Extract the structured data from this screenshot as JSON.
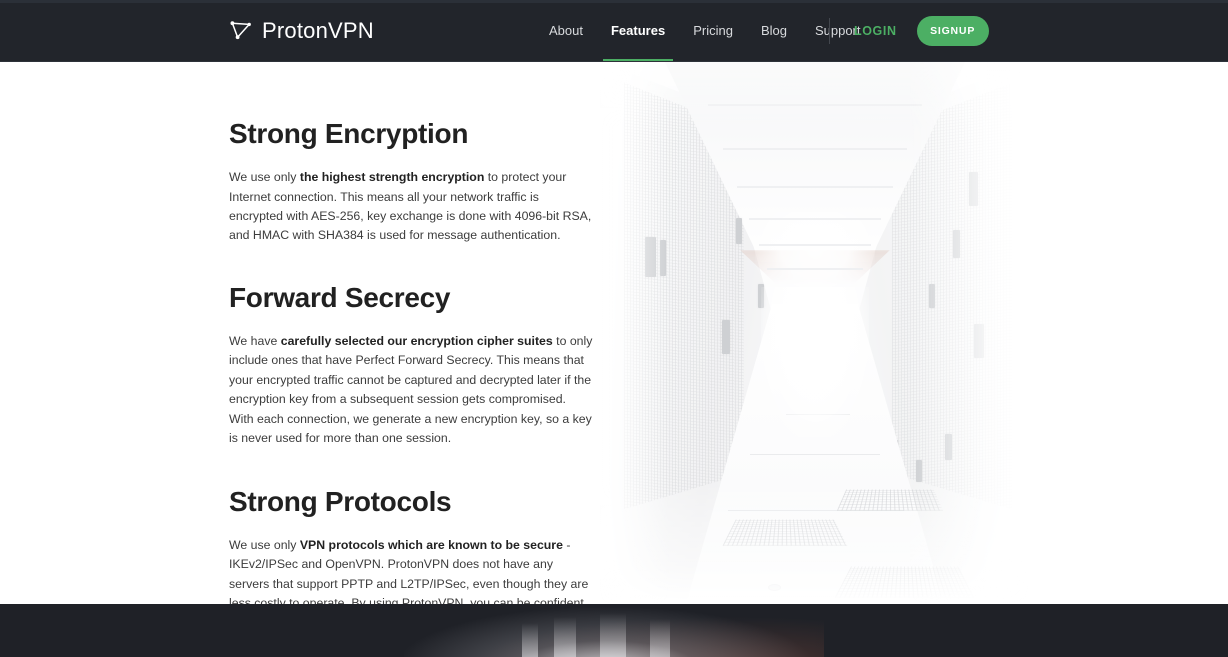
{
  "header": {
    "brand": {
      "name": "ProtonVPN",
      "icon": "proton-network-triangle-icon"
    },
    "nav": [
      {
        "label": "About",
        "active": false
      },
      {
        "label": "Features",
        "active": true
      },
      {
        "label": "Pricing",
        "active": false
      },
      {
        "label": "Blog",
        "active": false
      },
      {
        "label": "Support",
        "active": false
      }
    ],
    "login_label": "LOGIN",
    "signup_label": "SIGNUP",
    "colors": {
      "background": "#22252b",
      "accent_green": "#4caf64",
      "nav_text": "#d8dadd",
      "nav_active_text": "#ffffff"
    }
  },
  "main": {
    "sections": [
      {
        "title": "Strong Encryption",
        "body_lead": "We use only ",
        "body_bold": "the highest strength encryption",
        "body_rest": " to protect your Internet connection. This means all your network traffic is encrypted with AES-256, key exchange is done with 4096-bit RSA, and HMAC with SHA384 is used for message authentication."
      },
      {
        "title": "Forward Secrecy",
        "body_lead": "We have ",
        "body_bold": "carefully selected our encryption cipher suites",
        "body_rest": " to only include ones that have Perfect Forward Secrecy. This means that your encrypted traffic cannot be captured and decrypted later if the encryption key from a subsequent session gets compromised. With each connection, we generate a new encryption key, so a key is never used for more than one session."
      },
      {
        "title": "Strong Protocols",
        "body_lead": "We use only ",
        "body_bold": "VPN protocols which are known to be secure",
        "body_rest": " - IKEv2/IPSec and OpenVPN. ProtonVPN does not have any servers that support PPTP and L2TP/IPSec, even though they are less costly to operate. By using ProtonVPN, you can be confident that your VPN tunnel is protected by the most reliable protocol."
      }
    ],
    "hero_image": {
      "name": "data-center-corridor-photo",
      "alt": "Washed-out photo of a white data center server corridor"
    }
  },
  "footer": {
    "band_image": {
      "name": "dark-data-center-photo",
      "alt": "Dark photo band at page bottom"
    },
    "background": "#1f2127"
  }
}
